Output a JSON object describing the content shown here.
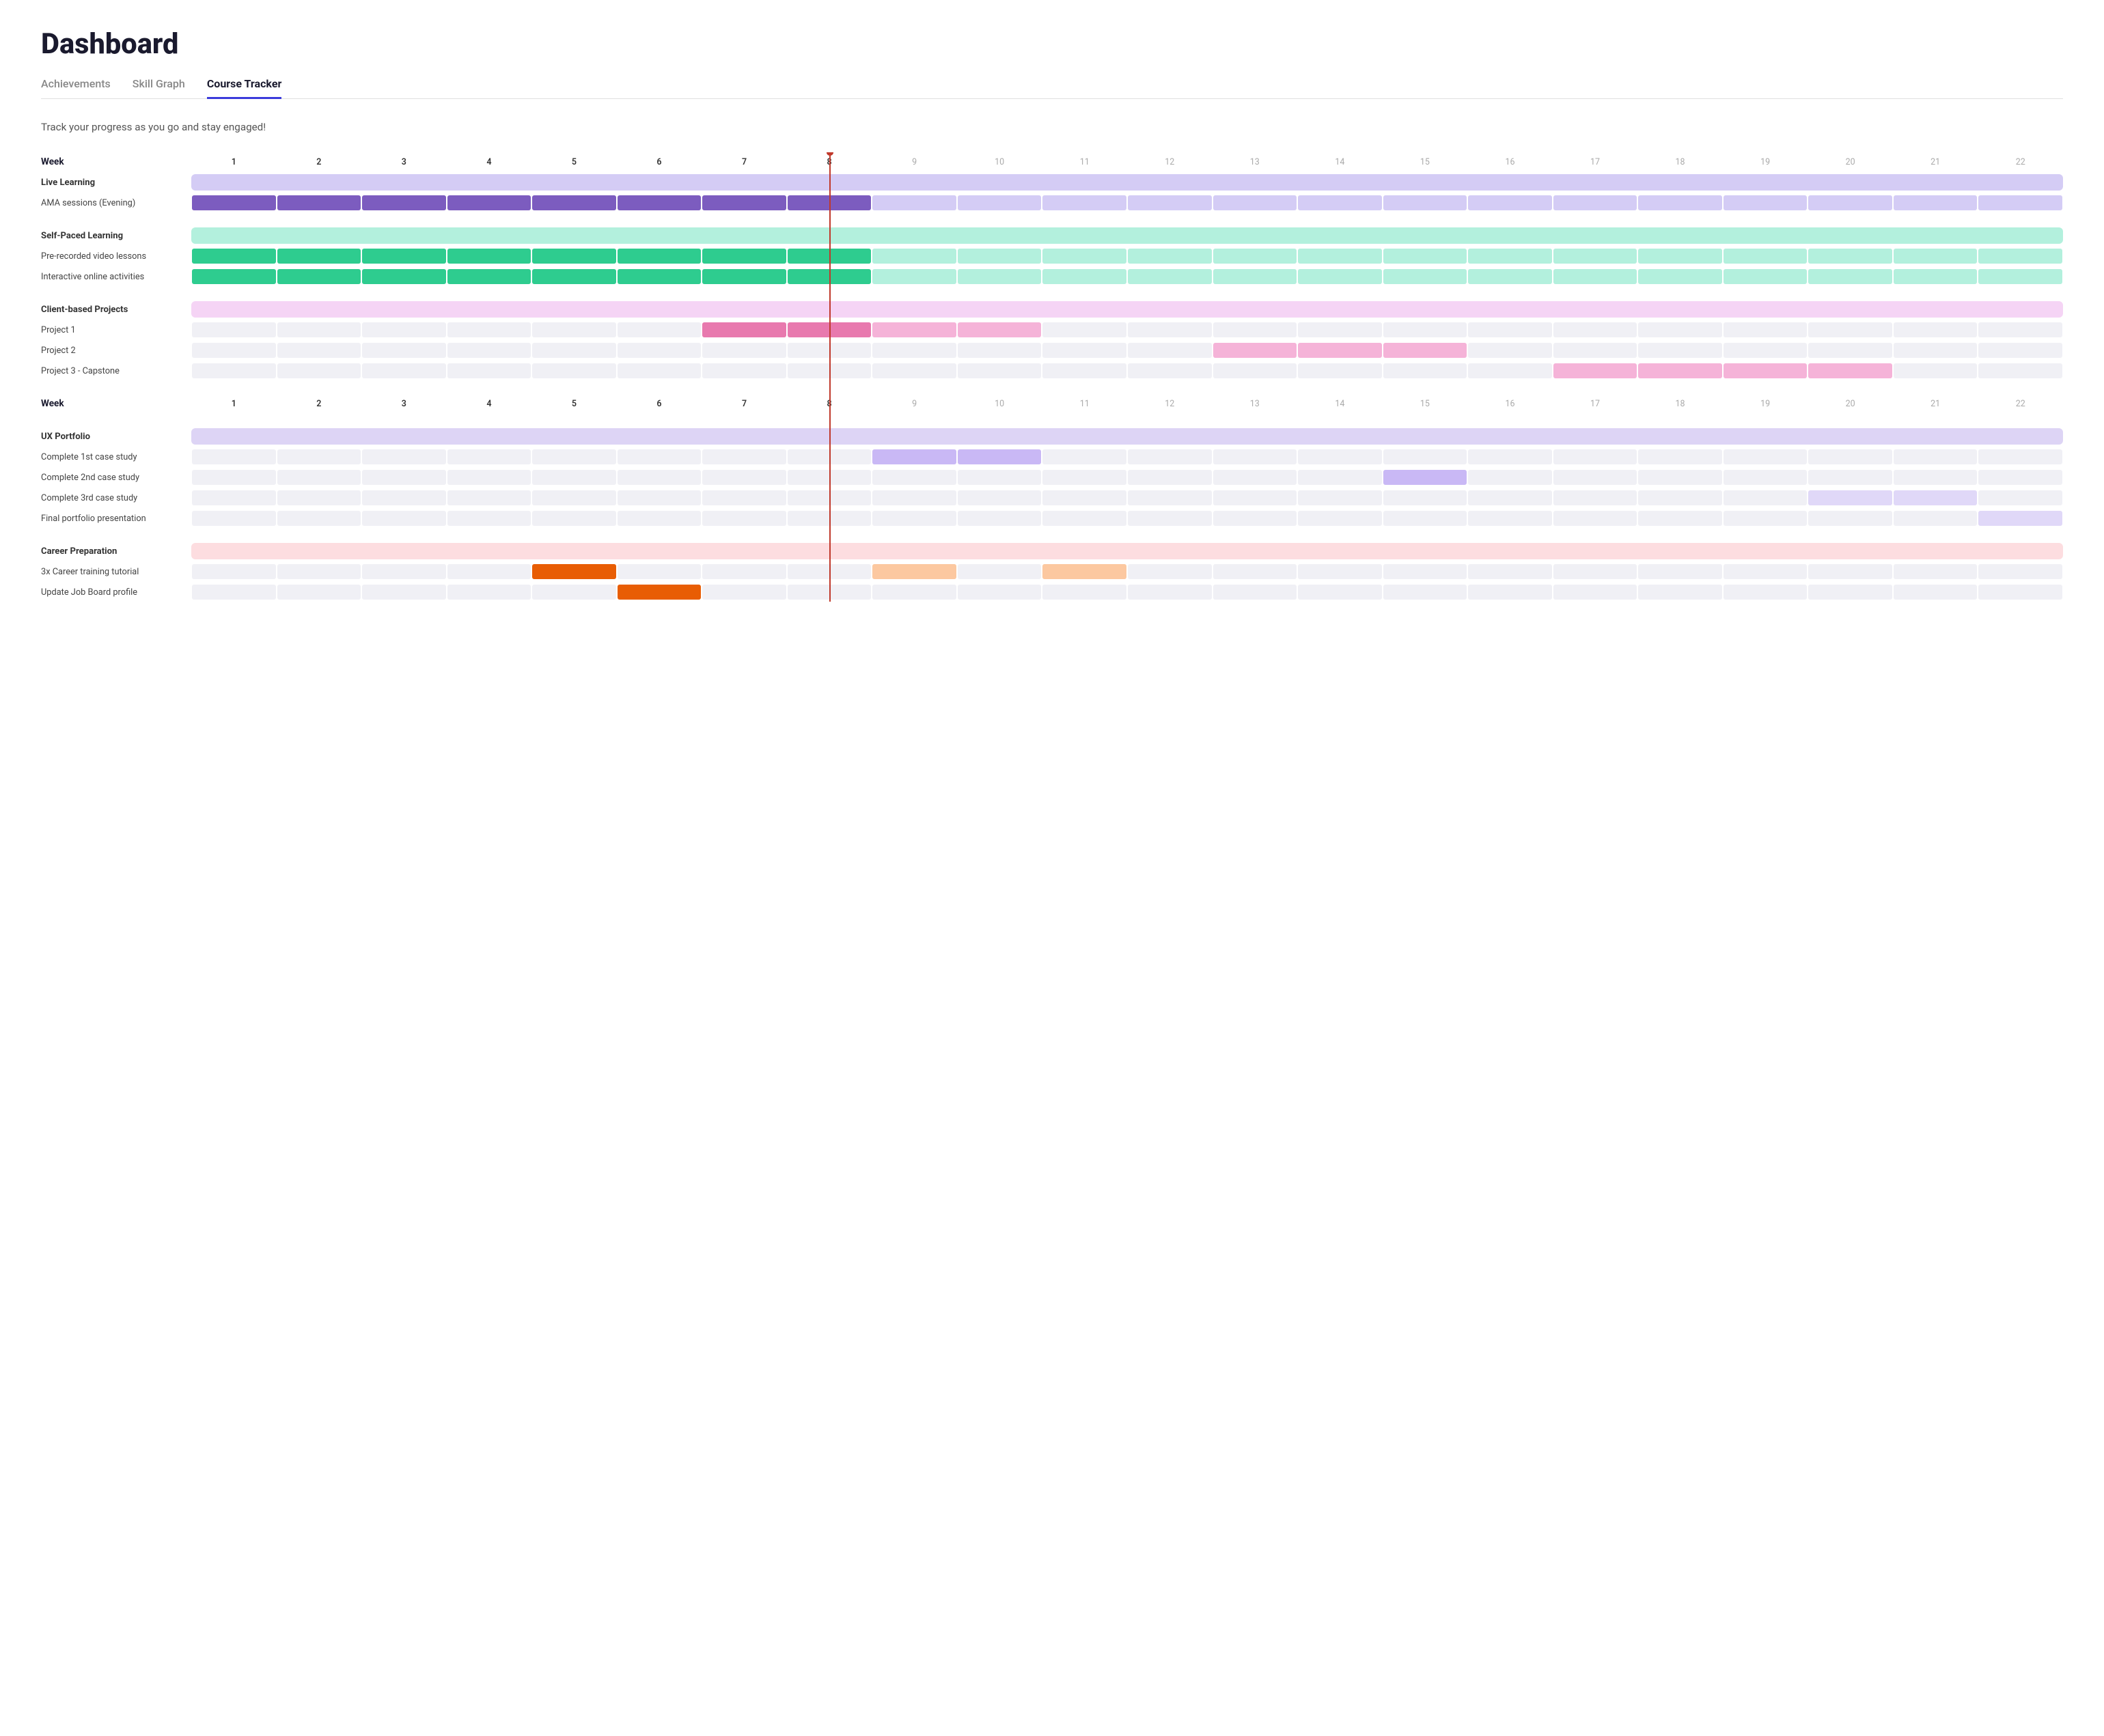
{
  "page": {
    "title": "Dashboard",
    "subtitle": "Track your progress as you go and stay engaged!",
    "tabs": [
      {
        "id": "achievements",
        "label": "Achievements",
        "active": false
      },
      {
        "id": "skill-graph",
        "label": "Skill Graph",
        "active": false
      },
      {
        "id": "course-tracker",
        "label": "Course Tracker",
        "active": true
      }
    ]
  },
  "gantt": {
    "current_week": 8,
    "weeks": [
      1,
      2,
      3,
      4,
      5,
      6,
      7,
      8,
      9,
      10,
      11,
      12,
      13,
      14,
      15,
      16,
      17,
      18,
      19,
      20,
      21,
      22
    ],
    "week_label": "Week",
    "sections": [
      {
        "id": "live-learning",
        "label": "Live Learning",
        "bg_color": "bg-live",
        "tasks": [
          {
            "label": "AMA sessions (Evening)",
            "bars": [
              {
                "start": 1,
                "end": 8,
                "color": "bar-purple"
              },
              {
                "start": 9,
                "end": 22,
                "color": "bar-purple-light"
              }
            ]
          }
        ]
      },
      {
        "id": "self-paced",
        "label": "Self-Paced Learning",
        "bg_color": "bg-self",
        "tasks": [
          {
            "label": "Pre-recorded video lessons",
            "bars": [
              {
                "start": 1,
                "end": 8,
                "color": "bar-green"
              },
              {
                "start": 9,
                "end": 22,
                "color": "bar-green-light"
              }
            ]
          },
          {
            "label": "Interactive online activities",
            "bars": [
              {
                "start": 1,
                "end": 8,
                "color": "bar-green"
              },
              {
                "start": 9,
                "end": 22,
                "color": "bar-green-light"
              }
            ]
          }
        ]
      },
      {
        "id": "client-projects",
        "label": "Client-based Projects",
        "bg_color": "bg-client",
        "tasks": [
          {
            "label": "Project 1",
            "bars": [
              {
                "start": 7,
                "end": 8,
                "color": "bar-pink"
              },
              {
                "start": 9,
                "end": 10,
                "color": "bar-pink-light"
              }
            ]
          },
          {
            "label": "Project 2",
            "bars": [
              {
                "start": 13,
                "end": 15,
                "color": "bar-pink-light"
              }
            ]
          },
          {
            "label": "Project 3 - Capstone",
            "bars": [
              {
                "start": 17,
                "end": 20,
                "color": "bar-pink-light"
              }
            ]
          }
        ]
      },
      {
        "id": "ux-portfolio",
        "label": "UX Portfolio",
        "bg_color": "bg-ux",
        "tasks": [
          {
            "label": "Complete 1st case study",
            "bars": [
              {
                "start": 9,
                "end": 10,
                "color": "bar-lavender"
              }
            ]
          },
          {
            "label": "Complete 2nd case study",
            "bars": [
              {
                "start": 15,
                "end": 15,
                "color": "bar-lavender"
              }
            ]
          },
          {
            "label": "Complete 3rd case study",
            "bars": [
              {
                "start": 20,
                "end": 21,
                "color": "bar-lavender-light"
              }
            ]
          },
          {
            "label": "Final portfolio presentation",
            "bars": [
              {
                "start": 22,
                "end": 22,
                "color": "bar-lavender-light"
              }
            ]
          }
        ]
      },
      {
        "id": "career-prep",
        "label": "Career Preparation",
        "bg_color": "bg-career",
        "tasks": [
          {
            "label": "3x Career training tutorial",
            "bars": [
              {
                "start": 5,
                "end": 5,
                "color": "bar-orange"
              },
              {
                "start": 9,
                "end": 9,
                "color": "bar-orange-light"
              },
              {
                "start": 11,
                "end": 11,
                "color": "bar-orange-light"
              }
            ]
          },
          {
            "label": "Update Job Board profile",
            "bars": [
              {
                "start": 6,
                "end": 6,
                "color": "bar-orange"
              }
            ]
          }
        ]
      }
    ]
  }
}
